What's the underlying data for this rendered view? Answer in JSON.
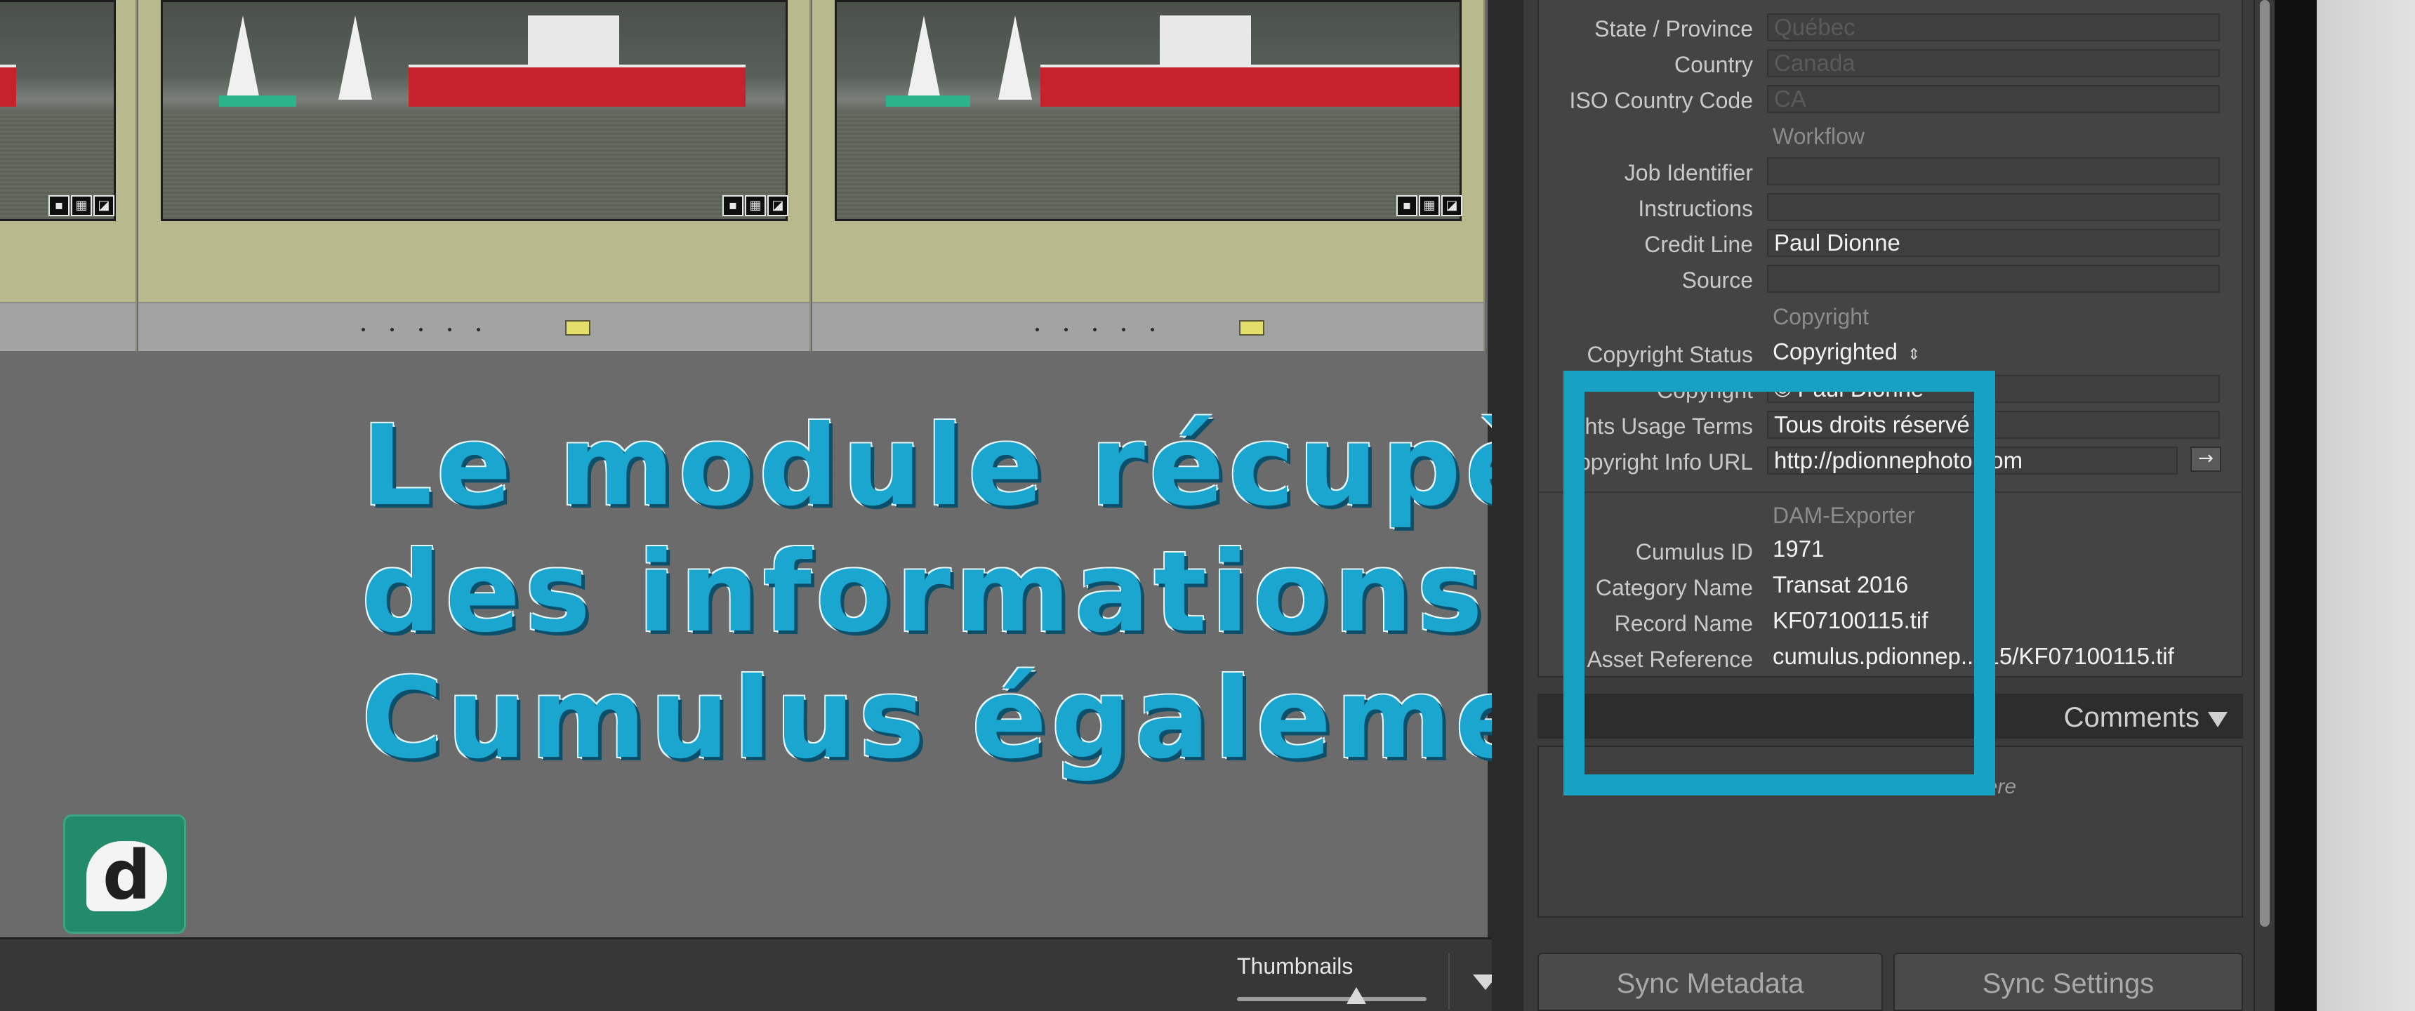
{
  "overlay": {
    "line1": "Le module récupère",
    "line2": "des informations de",
    "line3": "Cumulus également"
  },
  "logo": {
    "glyph": "d"
  },
  "toolbar": {
    "thumbnails_label": "Thumbnails",
    "thumbnail_size": 0.63
  },
  "grid": {
    "badges": [
      "flag-icon",
      "grid-icon",
      "crop-icon"
    ],
    "label_color": "#e3dd6b"
  },
  "metadata": {
    "location": [
      {
        "label": "State / Province",
        "value": "Québec",
        "dim": true
      },
      {
        "label": "Country",
        "value": "Canada",
        "dim": true
      },
      {
        "label": "ISO Country Code",
        "value": "CA",
        "dim": true
      }
    ],
    "workflow_title": "Workflow",
    "workflow": [
      {
        "label": "Job Identifier",
        "value": ""
      },
      {
        "label": "Instructions",
        "value": ""
      },
      {
        "label": "Credit Line",
        "value": "Paul Dionne"
      },
      {
        "label": "Source",
        "value": ""
      }
    ],
    "copyright_title": "Copyright",
    "copyright": [
      {
        "label": "Copyright Status",
        "value": "Copyrighted"
      },
      {
        "label": "Copyright",
        "value": "© Paul Dionne"
      },
      {
        "label": "ghts Usage Terms",
        "value": "Tous droits réservé"
      },
      {
        "label": "opyright Info URL",
        "value": "http://pdionnephoto.com"
      }
    ],
    "dam_title": "DAM-Exporter",
    "dam": [
      {
        "label": "Cumulus ID",
        "value": "1971"
      },
      {
        "label": "Category Name",
        "value": "Transat 2016"
      },
      {
        "label": "Record Name",
        "value": "KF07100115.tif"
      },
      {
        "label": "Asset Reference",
        "value": "cumulus.pdionnep.../15/KF07100115.tif"
      }
    ]
  },
  "comments": {
    "title": "Comments",
    "placeholder_tail": "here"
  },
  "sync": {
    "metadata": "Sync Metadata",
    "settings": "Sync Settings"
  },
  "colors": {
    "highlight": "#17a2c4",
    "overlay_text": "#1aa6cf"
  }
}
